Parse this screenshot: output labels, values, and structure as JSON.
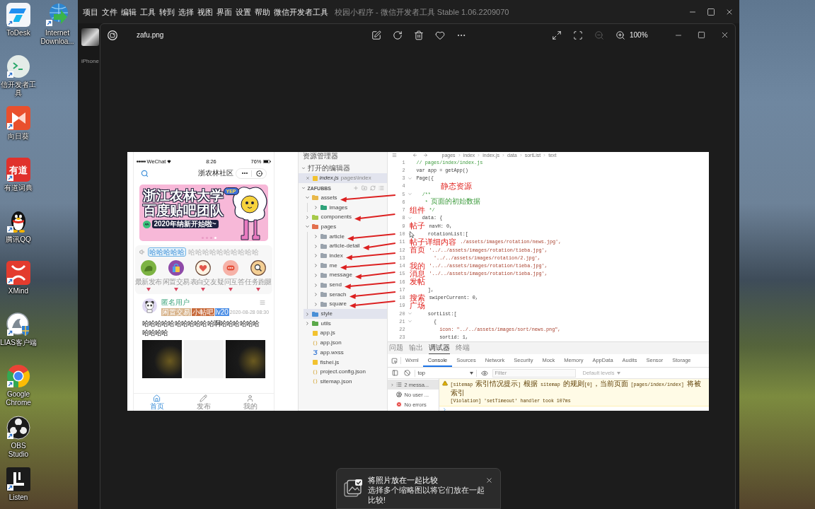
{
  "desktop": {
    "icons": [
      {
        "label": "ToDesk",
        "kind": "todesk"
      },
      {
        "label": "信开发者工具",
        "kind": "devtools"
      },
      {
        "label": "向日葵",
        "kind": "sunflower"
      },
      {
        "label": "有道词典",
        "kind": "youdao",
        "logo_text": "有道"
      },
      {
        "label": "腾讯QQ",
        "kind": "qq"
      },
      {
        "label": "XMind",
        "kind": "xmind"
      },
      {
        "label": "LIAS客户端",
        "kind": "ilias"
      },
      {
        "label": "Google Chrome",
        "kind": "chrome"
      },
      {
        "label": "OBS Studio",
        "kind": "obs"
      },
      {
        "label": "Listen",
        "kind": "listen"
      },
      {
        "label": "Internet Downloa...",
        "kind": "idm"
      }
    ]
  },
  "devtools_window": {
    "menu": [
      "项目",
      "文件",
      "编辑",
      "工具",
      "转到",
      "选择",
      "视图",
      "界面",
      "设置",
      "帮助",
      "微信开发者工具"
    ],
    "title": "校园小程序 - 微信开发者工具 Stable 1.06.2209070",
    "device_label": "iPhone"
  },
  "photo_viewer": {
    "file_name": "zafu.png",
    "actions": [
      {
        "kind": "edit",
        "disabled": false
      },
      {
        "kind": "rotate",
        "disabled": false
      },
      {
        "kind": "delete",
        "disabled": false
      },
      {
        "kind": "favorite",
        "disabled": false
      },
      {
        "kind": "more",
        "disabled": false
      }
    ],
    "view_controls": [
      {
        "kind": "fullscreen",
        "disabled": false
      },
      {
        "kind": "fit",
        "disabled": false
      },
      {
        "kind": "zoom_out",
        "disabled": true
      },
      {
        "kind": "zoom_in",
        "disabled": false
      }
    ],
    "zoom": "100%",
    "toast": {
      "title": "将照片放在一起比较",
      "body": "选择多个缩略图以将它们放在一起比较!"
    }
  },
  "screenshot": {
    "simulator": {
      "status_bar": {
        "carrier": "WeChat",
        "time": "8:26",
        "battery": "76%"
      },
      "title": "浙农林社区",
      "banner": {
        "badge": "YEP",
        "lines": [
          "浙江农林大学",
          "百度贴吧团队"
        ],
        "tagline": "2020年纳新开始啦~",
        "dots": [
          {
            "selected": false
          },
          {
            "selected": false
          },
          {
            "selected": false
          },
          {
            "selected": true
          }
        ]
      },
      "notice": {
        "tag": "哈哈哈哈哈",
        "text": "哈哈哈哈哈哈哈哈哈哈"
      },
      "categories": [
        {
          "label": "最新发布",
          "kind": "new"
        },
        {
          "label": "闲置交易",
          "kind": "trade"
        },
        {
          "label": "表白交友",
          "kind": "love"
        },
        {
          "label": "疑问互答",
          "kind": "question"
        },
        {
          "label": "任务跑腿",
          "kind": "task"
        }
      ],
      "post": {
        "author": "匿名用户",
        "tags": [
          {
            "label": "闲置交易",
            "color": "#d8b48c"
          },
          {
            "label": "小帖吧",
            "color": "#c86b3c"
          },
          {
            "label": "lv20",
            "color": "#4d8fe6"
          }
        ],
        "time": "2020-08-28 08:30",
        "text": "哈哈哈哈哈哈哈哈哈哈哈啊哈哈哈哈哈哈哈哈哈哈",
        "images": [
          {
            "kind": "photo"
          },
          {
            "kind": "sketch"
          },
          {
            "kind": "photo"
          }
        ]
      },
      "tabbar": [
        {
          "label": "首页",
          "kind": "home",
          "selected": true
        },
        {
          "label": "发布",
          "kind": "post",
          "selected": false
        },
        {
          "label": "我的",
          "kind": "profile",
          "selected": false
        }
      ]
    },
    "explorer": {
      "title": "资源管理器",
      "open_editors": {
        "label": "打开的编辑器",
        "expanded": true,
        "files": [
          {
            "name": "index.js",
            "path": "pages\\index",
            "kind": "js",
            "selected": true
          }
        ]
      },
      "project": {
        "label": "ZAFUBBS",
        "expanded": true,
        "items": [
          {
            "name": "assets",
            "kind": "folder",
            "color": "#e8b84a",
            "expanded": true,
            "selected": false,
            "arrow": true,
            "children": [
              {
                "name": "images",
                "kind": "folder",
                "color": "#2fa37a",
                "expanded": false,
                "selected": false,
                "arrow": false
              }
            ]
          },
          {
            "name": "components",
            "kind": "folder",
            "color": "#a6c94a",
            "expanded": false,
            "selected": false,
            "arrow": true
          },
          {
            "name": "pages",
            "kind": "folder",
            "color": "#e2704e",
            "expanded": true,
            "selected": false,
            "arrow": false,
            "children": [
              {
                "name": "article",
                "kind": "folder",
                "color": "#9aa3ad",
                "expanded": false,
                "selected": false,
                "arrow": true
              },
              {
                "name": "article-detail",
                "kind": "folder",
                "color": "#9aa3ad",
                "expanded": false,
                "selected": false,
                "arrow": true
              },
              {
                "name": "index",
                "kind": "folder",
                "color": "#9aa3ad",
                "expanded": false,
                "selected": false,
                "arrow": true
              },
              {
                "name": "me",
                "kind": "folder",
                "color": "#9aa3ad",
                "expanded": false,
                "selected": false,
                "arrow": true
              },
              {
                "name": "message",
                "kind": "folder",
                "color": "#9aa3ad",
                "expanded": false,
                "selected": false,
                "arrow": true
              },
              {
                "name": "send",
                "kind": "folder",
                "color": "#9aa3ad",
                "expanded": false,
                "selected": false,
                "arrow": true
              },
              {
                "name": "serach",
                "kind": "folder",
                "color": "#9aa3ad",
                "expanded": false,
                "selected": false,
                "arrow": true
              },
              {
                "name": "square",
                "kind": "folder",
                "color": "#9aa3ad",
                "expanded": false,
                "selected": false,
                "arrow": true
              }
            ]
          },
          {
            "name": "style",
            "kind": "folder",
            "color": "#4a8fd6",
            "expanded": false,
            "selected": true,
            "arrow": false
          },
          {
            "name": "utils",
            "kind": "folder",
            "color": "#5aa84a",
            "expanded": false,
            "selected": false,
            "arrow": false
          },
          {
            "name": "app.js",
            "kind": "js",
            "selected": false,
            "arrow": false
          },
          {
            "name": "app.json",
            "kind": "json",
            "selected": false,
            "arrow": false
          },
          {
            "name": "app.wxss",
            "kind": "wxss",
            "selected": false,
            "arrow": false
          },
          {
            "name": "fishei.js",
            "kind": "js",
            "selected": false,
            "arrow": false
          },
          {
            "name": "project.config.json",
            "kind": "json",
            "selected": false,
            "arrow": false
          },
          {
            "name": "sitemap.json",
            "kind": "json",
            "selected": false,
            "arrow": false
          }
        ]
      }
    },
    "editor": {
      "breadcrumb": [
        "pages",
        "index",
        "index.js",
        "data",
        "sortList",
        "text"
      ],
      "lines": [
        {
          "number": "1",
          "kind": "comment",
          "foldable": false,
          "text": "// pages/index/index.js"
        },
        {
          "number": "2",
          "kind": "code",
          "foldable": false,
          "text": "var app = getApp()"
        },
        {
          "number": "3",
          "kind": "code",
          "foldable": true,
          "text": "Page({"
        },
        {
          "number": "4",
          "kind": "code",
          "foldable": false,
          "annotation": {
            "text": "静态资源",
            "kind": "code"
          }
        },
        {
          "number": "5",
          "kind": "comment",
          "foldable": true,
          "text": "  /**"
        },
        {
          "number": "6",
          "kind": "comment",
          "foldable": false,
          "text": "   * 页面的初始数据"
        },
        {
          "number": "7",
          "kind": "comment",
          "foldable": false,
          "text": "*/",
          "annotation": {
            "text": "组件",
            "kind": "gutter"
          }
        },
        {
          "number": "8",
          "kind": "code",
          "foldable": true,
          "text": "  data: {"
        },
        {
          "number": "9",
          "kind": "code",
          "foldable": false,
          "text": "navH: 0,",
          "annotation": {
            "text": "帖子",
            "kind": "gutter"
          }
        },
        {
          "number": "10",
          "kind": "code",
          "foldable": true,
          "text": "    rotationList:["
        },
        {
          "number": "11",
          "kind": "string",
          "foldable": false,
          "text": "./assets/images/rotation/news.jpg',",
          "annotation": {
            "text": "帖子详细内容",
            "kind": "gutter"
          }
        },
        {
          "number": "12",
          "kind": "string",
          "foldable": false,
          "text": "'../../assets/images/rotation/tieba.jpg',",
          "annotation": {
            "text": "首页",
            "kind": "gutter"
          }
        },
        {
          "number": "13",
          "kind": "string",
          "foldable": false,
          "text": "      '../../assets/images/rotation/2.jpg',"
        },
        {
          "number": "14",
          "kind": "string",
          "foldable": false,
          "text": "'../../assets/images/rotation/tieba.jpg',",
          "annotation": {
            "text": "我的",
            "kind": "gutter"
          }
        },
        {
          "number": "15",
          "kind": "string",
          "foldable": false,
          "text": "'../../assets/images/rotation/tieba.jpg',",
          "annotation": {
            "text": "消息",
            "kind": "gutter"
          }
        },
        {
          "number": "16",
          "kind": "code",
          "foldable": false,
          "annotation": {
            "text": "发帖",
            "kind": "gutter"
          }
        },
        {
          "number": "17",
          "kind": "code",
          "foldable": false,
          "text": "    ],"
        },
        {
          "number": "18",
          "kind": "code",
          "foldable": false,
          "text": "swiperCurrent: 0,",
          "annotation": {
            "text": "搜索",
            "kind": "gutter"
          }
        },
        {
          "number": "19",
          "kind": "code",
          "foldable": false,
          "annotation": {
            "text": "广场",
            "kind": "gutter"
          }
        },
        {
          "number": "20",
          "kind": "code",
          "foldable": true,
          "text": "    sortList:["
        },
        {
          "number": "21",
          "kind": "code",
          "foldable": true,
          "text": "      {"
        },
        {
          "number": "22",
          "kind": "string",
          "foldable": false,
          "text": "        icon: \"../../assets/images/sort/news.png\","
        },
        {
          "number": "23",
          "kind": "code",
          "foldable": false,
          "text": "        sortid: 1,"
        }
      ]
    },
    "console": {
      "panel_tabs": [
        {
          "label": "问题",
          "selected": false
        },
        {
          "label": "输出",
          "selected": false
        },
        {
          "label": "调试器",
          "selected": true
        },
        {
          "label": "终端",
          "selected": false
        }
      ],
      "devtools_tabs": [
        {
          "label": "Wxml",
          "selected": false
        },
        {
          "label": "Console",
          "selected": true
        },
        {
          "label": "Sources",
          "selected": false
        },
        {
          "label": "Network",
          "selected": false
        },
        {
          "label": "Security",
          "selected": false
        },
        {
          "label": "Mock",
          "selected": false
        },
        {
          "label": "Memory",
          "selected": false
        },
        {
          "label": "AppData",
          "selected": false
        },
        {
          "label": "Audits",
          "selected": false
        },
        {
          "label": "Sensor",
          "selected": false
        },
        {
          "label": "Storage",
          "selected": false
        }
      ],
      "context": "top",
      "filter_placeholder": "Filter",
      "levels": "Default levels",
      "sidebar": [
        {
          "label": "2 messa...",
          "kind": "messages",
          "selected": true
        },
        {
          "label": "No user ...",
          "kind": "user",
          "selected": false
        },
        {
          "label": "No errors",
          "kind": "errors",
          "selected": false
        }
      ],
      "messages": [
        {
          "kind": "warning",
          "text": "[sitemap 索引情况提示] 根据 sitemap 的规则[0]，当前页面 [pages/index/index] 将被索引"
        },
        {
          "kind": "violation",
          "text": "[Violation] 'setTimeout' handler took 107ms"
        }
      ]
    }
  }
}
